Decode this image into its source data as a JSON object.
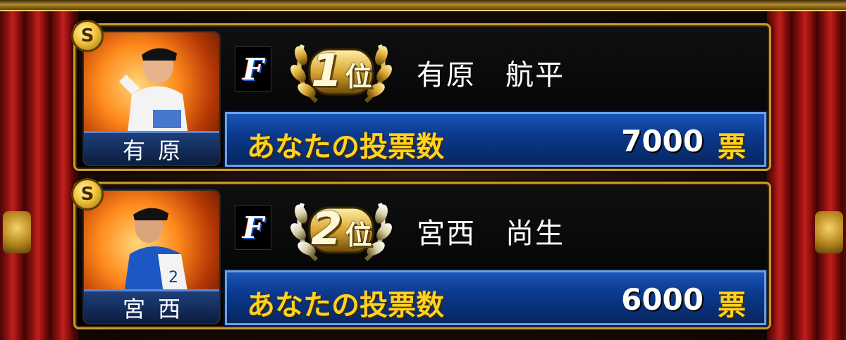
{
  "ranking": [
    {
      "rank_badge": "S",
      "short_name": "有原",
      "team_logo": "F",
      "rank_number": "1",
      "rank_suffix": "位",
      "player_name": "有原　航平",
      "vote_label": "あなたの投票数",
      "vote_count": "7000",
      "vote_unit": "票"
    },
    {
      "rank_badge": "S",
      "short_name": "宮西",
      "team_logo": "F",
      "rank_number": "2",
      "rank_suffix": "位",
      "player_name": "宮西　尚生",
      "vote_label": "あなたの投票数",
      "vote_count": "6000",
      "vote_unit": "票"
    }
  ],
  "colors": {
    "gold_border": "#c99a2e",
    "vote_label": "#ffd21f",
    "vote_bar": "#0b3a8e",
    "curtain": "#c0201c"
  },
  "icons": {
    "rank_badge": "s-rank-badge-icon",
    "team": "fighters-f-logo-icon",
    "laurel": "laurel-wreath-icon"
  }
}
